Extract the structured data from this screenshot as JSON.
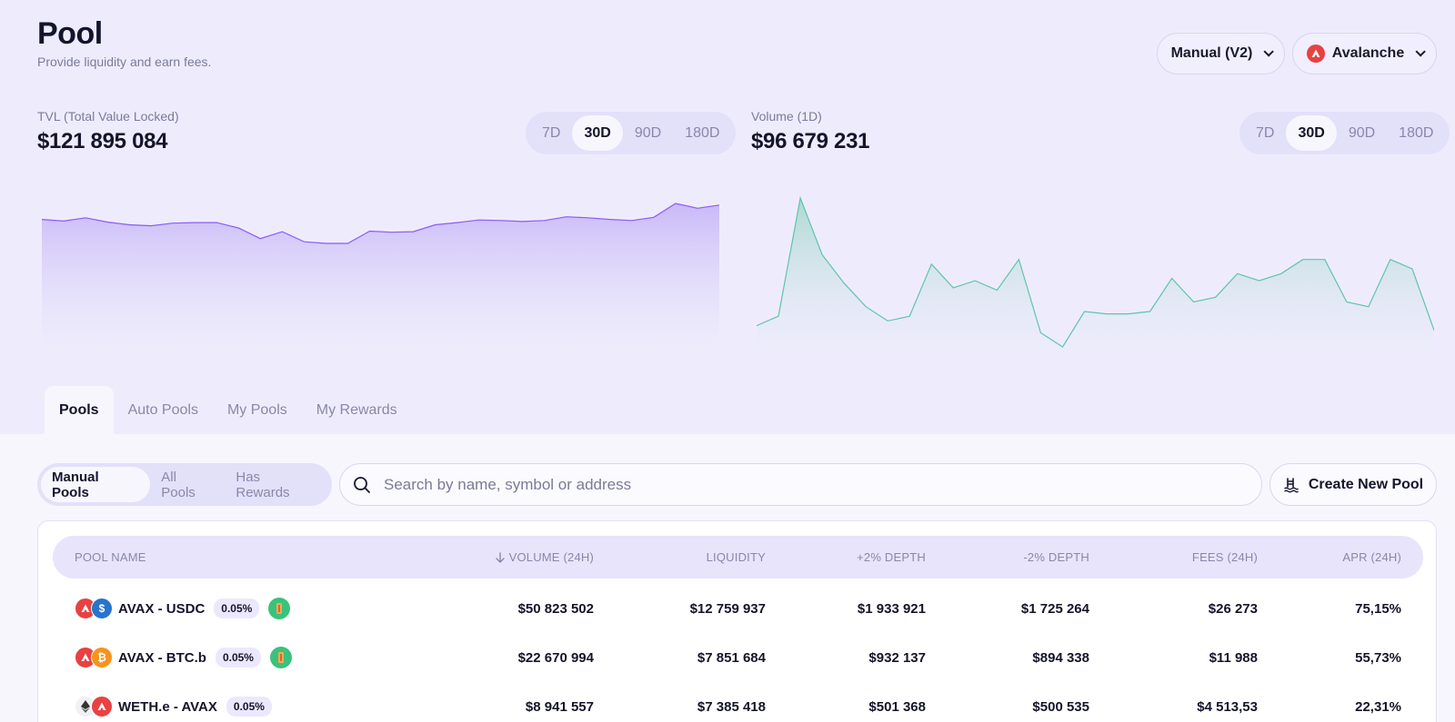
{
  "header": {
    "title": "Pool",
    "subtitle": "Provide liquidity and earn fees.",
    "version_selector": "Manual (V2)",
    "network_selector": "Avalanche"
  },
  "tvl": {
    "label": "TVL (Total Value Locked)",
    "value": "$121 895 084",
    "ranges": [
      "7D",
      "30D",
      "90D",
      "180D"
    ],
    "selected_range": "30D",
    "series": [
      118.5,
      118.2,
      118.8,
      118.0,
      117.5,
      117.3,
      117.8,
      117.9,
      117.9,
      116.9,
      114.9,
      116.2,
      114.3,
      114.0,
      114.0,
      116.3,
      116.1,
      116.2,
      117.5,
      117.9,
      118.4,
      118.3,
      118.1,
      118.3,
      119.0,
      118.8,
      118.5,
      118.3,
      118.9,
      121.5,
      120.6,
      121.2
    ],
    "color": "#8b5cf6"
  },
  "volume": {
    "label": "Volume (1D)",
    "value": "$96 679 231",
    "ranges": [
      "7D",
      "30D",
      "90D",
      "180D"
    ],
    "selected_range": "30D",
    "series": [
      98,
      102,
      152,
      128,
      116,
      106,
      100,
      102,
      124,
      114,
      117,
      113,
      126,
      95,
      89,
      104,
      103,
      103,
      104,
      118,
      108,
      110,
      120,
      117,
      120,
      126,
      126,
      108,
      106,
      126,
      122,
      96
    ],
    "color": "#5ec4ad"
  },
  "tabs": [
    "Pools",
    "Auto Pools",
    "My Pools",
    "My Rewards"
  ],
  "filters": [
    "Manual Pools",
    "All Pools",
    "Has Rewards"
  ],
  "search": {
    "placeholder": "Search by name, symbol or address"
  },
  "create_button": "Create New Pool",
  "table": {
    "columns": [
      "POOL NAME",
      "VOLUME (24H)",
      "LIQUIDITY",
      "+2% DEPTH",
      "-2% DEPTH",
      "FEES (24H)",
      "APR (24H)"
    ],
    "rows": [
      {
        "pair": "AVAX - USDC",
        "fee": "0.05%",
        "volume": "$50 823 502",
        "liquidity": "$12 759 937",
        "depth_plus": "$1 933 921",
        "depth_minus": "$1 725 264",
        "fees": "$26 273",
        "apr": "75,15%",
        "tokens": [
          "avax",
          "usdc"
        ],
        "rewards": true
      },
      {
        "pair": "AVAX - BTC.b",
        "fee": "0.05%",
        "volume": "$22 670 994",
        "liquidity": "$7 851 684",
        "depth_plus": "$932 137",
        "depth_minus": "$894 338",
        "fees": "$11 988",
        "apr": "55,73%",
        "tokens": [
          "avax",
          "btc"
        ],
        "rewards": true
      },
      {
        "pair": "WETH.e - AVAX",
        "fee": "0.05%",
        "volume": "$8 941 557",
        "liquidity": "$7 385 418",
        "depth_plus": "$501 368",
        "depth_minus": "$500 535",
        "fees": "$4 513,53",
        "apr": "22,31%",
        "tokens": [
          "eth",
          "avax"
        ],
        "rewards": false
      }
    ]
  }
}
